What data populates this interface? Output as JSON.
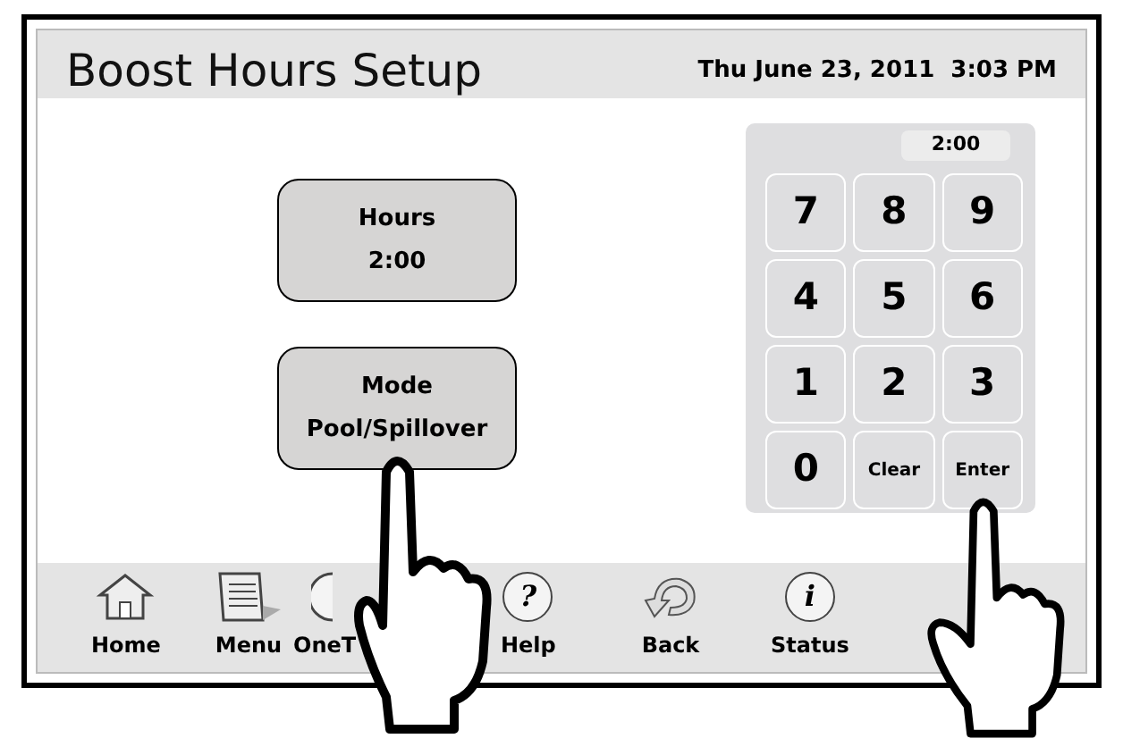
{
  "header": {
    "title": "Boost Hours Setup",
    "datetime": "Thu June 23, 2011  3:03 PM"
  },
  "settings": [
    {
      "label": "Hours",
      "value": "2:00"
    },
    {
      "label": "Mode",
      "value": "Pool/Spillover"
    }
  ],
  "keypad": {
    "display": "2:00",
    "keys": [
      {
        "label": "7",
        "kind": "digit"
      },
      {
        "label": "8",
        "kind": "digit"
      },
      {
        "label": "9",
        "kind": "digit"
      },
      {
        "label": "4",
        "kind": "digit"
      },
      {
        "label": "5",
        "kind": "digit"
      },
      {
        "label": "6",
        "kind": "digit"
      },
      {
        "label": "1",
        "kind": "digit"
      },
      {
        "label": "2",
        "kind": "digit"
      },
      {
        "label": "3",
        "kind": "digit"
      },
      {
        "label": "0",
        "kind": "digit"
      },
      {
        "label": "Clear",
        "kind": "action"
      },
      {
        "label": "Enter",
        "kind": "action"
      }
    ]
  },
  "toolbar": [
    {
      "label": "Home",
      "kind": "home"
    },
    {
      "label": "Menu",
      "kind": "menu"
    },
    {
      "label": "OneT",
      "kind": "onetouch"
    },
    {
      "label": "Help",
      "kind": "help",
      "glyph": "?"
    },
    {
      "label": "Back",
      "kind": "back"
    },
    {
      "label": "Status",
      "kind": "status",
      "glyph": "i"
    }
  ]
}
